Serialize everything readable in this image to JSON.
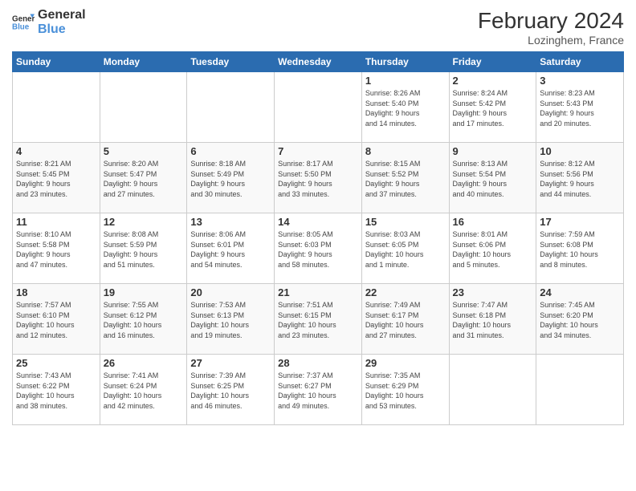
{
  "logo": {
    "line1": "General",
    "line2": "Blue"
  },
  "title": "February 2024",
  "location": "Lozinghem, France",
  "days": [
    "Sunday",
    "Monday",
    "Tuesday",
    "Wednesday",
    "Thursday",
    "Friday",
    "Saturday"
  ],
  "weeks": [
    [
      {
        "num": "",
        "info": ""
      },
      {
        "num": "",
        "info": ""
      },
      {
        "num": "",
        "info": ""
      },
      {
        "num": "",
        "info": ""
      },
      {
        "num": "1",
        "info": "Sunrise: 8:26 AM\nSunset: 5:40 PM\nDaylight: 9 hours\nand 14 minutes."
      },
      {
        "num": "2",
        "info": "Sunrise: 8:24 AM\nSunset: 5:42 PM\nDaylight: 9 hours\nand 17 minutes."
      },
      {
        "num": "3",
        "info": "Sunrise: 8:23 AM\nSunset: 5:43 PM\nDaylight: 9 hours\nand 20 minutes."
      }
    ],
    [
      {
        "num": "4",
        "info": "Sunrise: 8:21 AM\nSunset: 5:45 PM\nDaylight: 9 hours\nand 23 minutes."
      },
      {
        "num": "5",
        "info": "Sunrise: 8:20 AM\nSunset: 5:47 PM\nDaylight: 9 hours\nand 27 minutes."
      },
      {
        "num": "6",
        "info": "Sunrise: 8:18 AM\nSunset: 5:49 PM\nDaylight: 9 hours\nand 30 minutes."
      },
      {
        "num": "7",
        "info": "Sunrise: 8:17 AM\nSunset: 5:50 PM\nDaylight: 9 hours\nand 33 minutes."
      },
      {
        "num": "8",
        "info": "Sunrise: 8:15 AM\nSunset: 5:52 PM\nDaylight: 9 hours\nand 37 minutes."
      },
      {
        "num": "9",
        "info": "Sunrise: 8:13 AM\nSunset: 5:54 PM\nDaylight: 9 hours\nand 40 minutes."
      },
      {
        "num": "10",
        "info": "Sunrise: 8:12 AM\nSunset: 5:56 PM\nDaylight: 9 hours\nand 44 minutes."
      }
    ],
    [
      {
        "num": "11",
        "info": "Sunrise: 8:10 AM\nSunset: 5:58 PM\nDaylight: 9 hours\nand 47 minutes."
      },
      {
        "num": "12",
        "info": "Sunrise: 8:08 AM\nSunset: 5:59 PM\nDaylight: 9 hours\nand 51 minutes."
      },
      {
        "num": "13",
        "info": "Sunrise: 8:06 AM\nSunset: 6:01 PM\nDaylight: 9 hours\nand 54 minutes."
      },
      {
        "num": "14",
        "info": "Sunrise: 8:05 AM\nSunset: 6:03 PM\nDaylight: 9 hours\nand 58 minutes."
      },
      {
        "num": "15",
        "info": "Sunrise: 8:03 AM\nSunset: 6:05 PM\nDaylight: 10 hours\nand 1 minute."
      },
      {
        "num": "16",
        "info": "Sunrise: 8:01 AM\nSunset: 6:06 PM\nDaylight: 10 hours\nand 5 minutes."
      },
      {
        "num": "17",
        "info": "Sunrise: 7:59 AM\nSunset: 6:08 PM\nDaylight: 10 hours\nand 8 minutes."
      }
    ],
    [
      {
        "num": "18",
        "info": "Sunrise: 7:57 AM\nSunset: 6:10 PM\nDaylight: 10 hours\nand 12 minutes."
      },
      {
        "num": "19",
        "info": "Sunrise: 7:55 AM\nSunset: 6:12 PM\nDaylight: 10 hours\nand 16 minutes."
      },
      {
        "num": "20",
        "info": "Sunrise: 7:53 AM\nSunset: 6:13 PM\nDaylight: 10 hours\nand 19 minutes."
      },
      {
        "num": "21",
        "info": "Sunrise: 7:51 AM\nSunset: 6:15 PM\nDaylight: 10 hours\nand 23 minutes."
      },
      {
        "num": "22",
        "info": "Sunrise: 7:49 AM\nSunset: 6:17 PM\nDaylight: 10 hours\nand 27 minutes."
      },
      {
        "num": "23",
        "info": "Sunrise: 7:47 AM\nSunset: 6:18 PM\nDaylight: 10 hours\nand 31 minutes."
      },
      {
        "num": "24",
        "info": "Sunrise: 7:45 AM\nSunset: 6:20 PM\nDaylight: 10 hours\nand 34 minutes."
      }
    ],
    [
      {
        "num": "25",
        "info": "Sunrise: 7:43 AM\nSunset: 6:22 PM\nDaylight: 10 hours\nand 38 minutes."
      },
      {
        "num": "26",
        "info": "Sunrise: 7:41 AM\nSunset: 6:24 PM\nDaylight: 10 hours\nand 42 minutes."
      },
      {
        "num": "27",
        "info": "Sunrise: 7:39 AM\nSunset: 6:25 PM\nDaylight: 10 hours\nand 46 minutes."
      },
      {
        "num": "28",
        "info": "Sunrise: 7:37 AM\nSunset: 6:27 PM\nDaylight: 10 hours\nand 49 minutes."
      },
      {
        "num": "29",
        "info": "Sunrise: 7:35 AM\nSunset: 6:29 PM\nDaylight: 10 hours\nand 53 minutes."
      },
      {
        "num": "",
        "info": ""
      },
      {
        "num": "",
        "info": ""
      }
    ]
  ]
}
